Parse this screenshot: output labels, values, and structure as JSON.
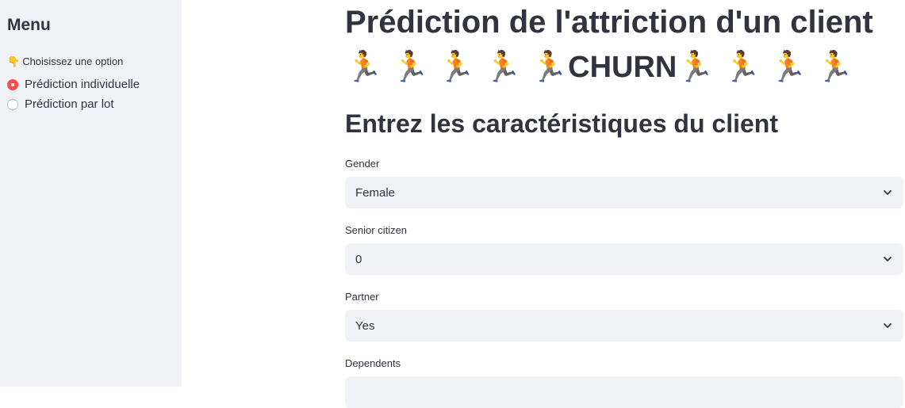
{
  "sidebar": {
    "title": "Menu",
    "prompt": "Choisissez une option",
    "prompt_icon": "pointing-hand",
    "options": [
      {
        "label": "Prédiction individuelle",
        "selected": true
      },
      {
        "label": "Prédiction par lot",
        "selected": false
      }
    ]
  },
  "main": {
    "title": "Prédiction de l'attriction d'un client",
    "title_line2_word": "CHURN",
    "runner_emoji": "🏃",
    "subheader": "Entrez les caractéristiques du client",
    "fields": [
      {
        "label": "Gender",
        "value": "Female"
      },
      {
        "label": "Senior citizen",
        "value": "0"
      },
      {
        "label": "Partner",
        "value": "Yes"
      },
      {
        "label": "Dependents",
        "value": ""
      }
    ]
  },
  "colors": {
    "accent": "#ff4b4b",
    "sidebar_bg": "#f0f2f6",
    "text": "#31333f"
  }
}
